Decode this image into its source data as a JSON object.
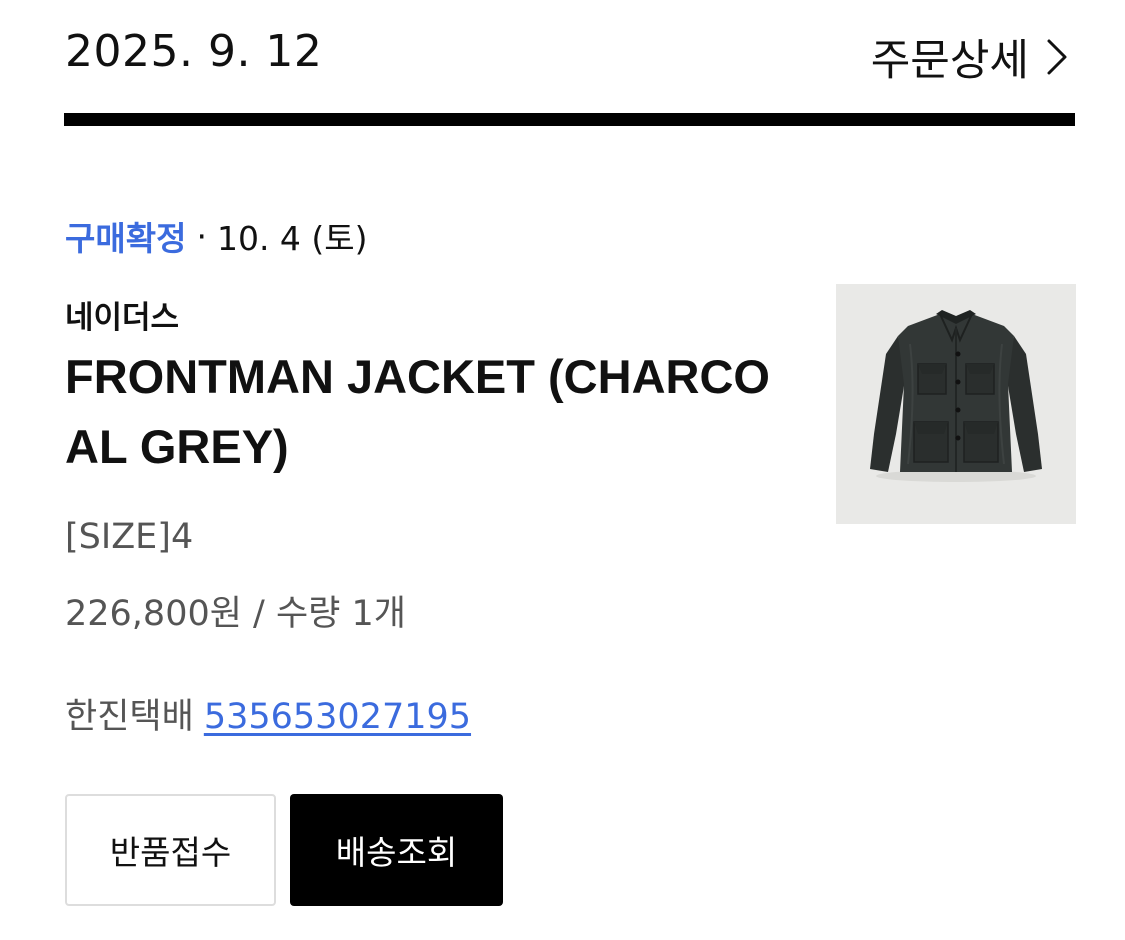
{
  "order": {
    "date": "2025. 9. 12",
    "detail_label": "주문상세"
  },
  "status": {
    "label": "구매확정",
    "separator": "·",
    "date": "10. 4 (토)"
  },
  "product": {
    "brand": "네이더스",
    "name": "FRONTMAN JACKET (CHARCOAL GREY)",
    "option": "[SIZE]4",
    "price_qty": "226,800원 / 수량 1개",
    "image_icon": "jacket-product-image"
  },
  "shipping": {
    "courier": "한진택배",
    "tracking_number": "535653027195"
  },
  "buttons": {
    "return_label": "반품접수",
    "track_label": "배송조회"
  },
  "colors": {
    "accent_blue": "#3b6bde",
    "primary_black": "#000000",
    "secondary_text": "#555555",
    "image_bg": "#e9e9e7"
  }
}
